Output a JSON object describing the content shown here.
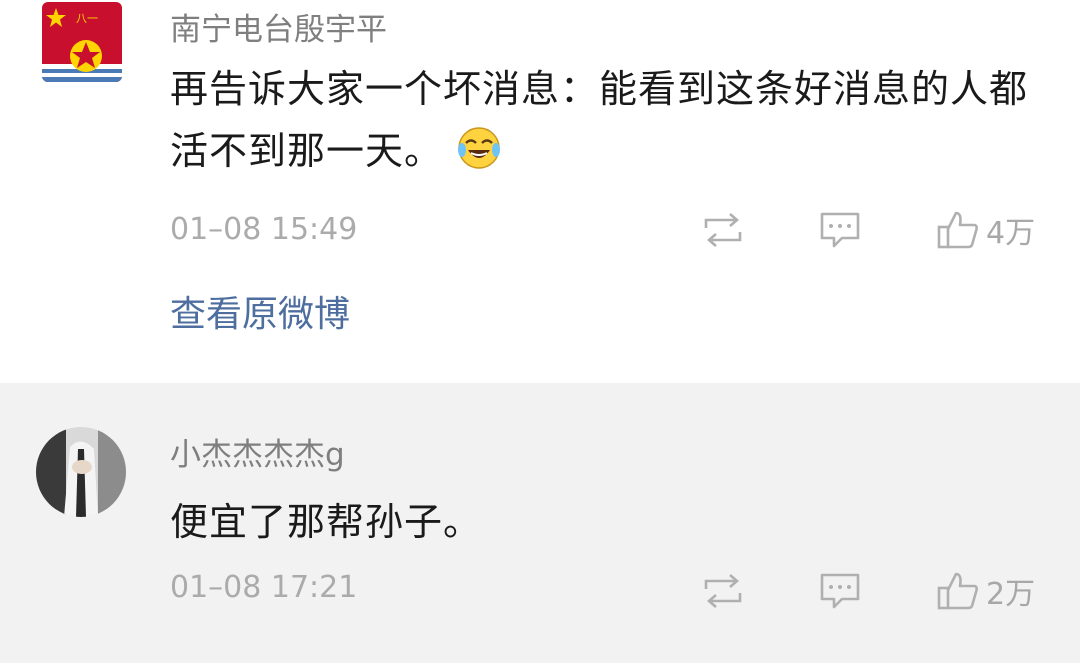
{
  "comments": [
    {
      "username": "南宁电台殷宇平",
      "content": "再告诉大家一个坏消息：能看到这条好消息的人都活不到那一天。",
      "emoji": "laugh-cry-emoji",
      "time": "01–08 15:49",
      "likes": "4万",
      "link": "查看原微博"
    },
    {
      "username": "小杰杰杰杰g",
      "content": "便宜了那帮孙子。",
      "time": "01–08 17:21",
      "likes": "2万"
    }
  ],
  "colors": {
    "username": "#7f7f7f",
    "link": "#4d6e9e",
    "meta": "#ababab",
    "second_bg": "#f2f2f2"
  },
  "icons": [
    "repost-icon",
    "reply-icon",
    "thumbs-up-icon"
  ]
}
